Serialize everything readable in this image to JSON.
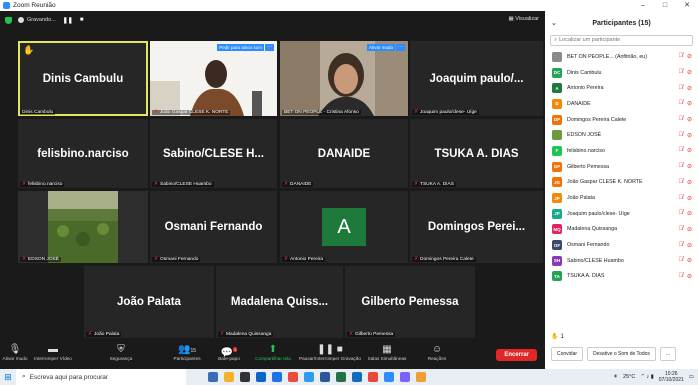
{
  "window": {
    "title": "Zoom Reunião",
    "min": "–",
    "max": "□",
    "close": "✕"
  },
  "meeting": {
    "recording_label": "Gravando...",
    "view_label": "Visualizar"
  },
  "tiles": [
    {
      "name": "Dinis Cambulu",
      "label": "Dinis Cambulu",
      "muted": false
    },
    {
      "name": "",
      "label": "João Gaspar CLESE K. NORTE",
      "muted": true,
      "unmute": "Pedir para ativar som"
    },
    {
      "name": "",
      "label": "BET ON PEOPLE - Cristina Afonso",
      "muted": false,
      "unmute": "Ativar mudo"
    },
    {
      "name": "Joaquim  paulo/...",
      "label": "Joaquim  paulo/clese- Uíge",
      "muted": true
    },
    {
      "name": "felisbino.narciso",
      "label": "felisbino.narciso",
      "muted": true
    },
    {
      "name": "Sabino/CLESE  H...",
      "label": "Sabino/CLESE Huambo",
      "muted": true
    },
    {
      "name": "DANAIDE",
      "label": "DANAIDE",
      "muted": true
    },
    {
      "name": "TSUKA A. DIAS",
      "label": "TSUKA A. DIAS",
      "muted": true
    },
    {
      "name": "",
      "label": "EDSON JOSÉ",
      "muted": true
    },
    {
      "name": "Osmani Fernando",
      "label": "Osmani Fernando",
      "muted": true
    },
    {
      "name": "",
      "label": "Antonio Pereira",
      "muted": true,
      "avatar": "A"
    },
    {
      "name": "Domingos  Perei...",
      "label": "Domingos Pereira Calete",
      "muted": true
    },
    {
      "name": "João Palata",
      "label": "João Palata",
      "muted": true
    },
    {
      "name": "Madalena  Quiss...",
      "label": "Madalena  Quissanga",
      "muted": true
    },
    {
      "name": "Gilberto Pemessa",
      "label": "Gilberto Pemessa",
      "muted": true
    }
  ],
  "toolbar": {
    "mute": "Ativar mudo",
    "video": "Interromper Vídeo",
    "security": "Segurança",
    "participants": "Participantes",
    "participants_count": "15",
    "chat": "Bate-papo",
    "chat_badge": "1",
    "share": "Compartilhar tela",
    "record": "Pausar/Interromper Gravação",
    "rooms": "Salas Simultâneas",
    "reactions": "Reações",
    "end": "Encerrar"
  },
  "panel": {
    "title": "Participantes (15)",
    "search_placeholder": "Localizar um participante",
    "participants": [
      {
        "initials": "",
        "name": "BET ON PEOPLE... (Anfitrião, eu)",
        "color": "#8a8a8a"
      },
      {
        "initials": "DC",
        "name": "Dinis Cambulu",
        "color": "#23a455"
      },
      {
        "initials": "A",
        "name": "Antonio Pereira",
        "color": "#1d7a3a"
      },
      {
        "initials": "D",
        "name": "DANAIDE",
        "color": "#f08a0c"
      },
      {
        "initials": "DP",
        "name": "Domingos Pereira Calete",
        "color": "#f0740c"
      },
      {
        "initials": "",
        "name": "EDSON JOSÉ",
        "color": "#6b9b3a"
      },
      {
        "initials": "F",
        "name": "felisbino.narciso",
        "color": "#23c552"
      },
      {
        "initials": "GP",
        "name": "Gilberto Pemessa",
        "color": "#f0740c"
      },
      {
        "initials": "JG",
        "name": "João Gaspar CLESE K. NORTE",
        "color": "#f0740c"
      },
      {
        "initials": "JP",
        "name": "João Palata",
        "color": "#f08a0c"
      },
      {
        "initials": "JP",
        "name": "Joaquim  paulo/clese- Uíge",
        "color": "#1aaa8a"
      },
      {
        "initials": "MQ",
        "name": "Madalena  Quissanga",
        "color": "#e0245e"
      },
      {
        "initials": "OF",
        "name": "Osmani Fernando",
        "color": "#3a4a6b"
      },
      {
        "initials": "SH",
        "name": "Sabino/CLESE Huambo",
        "color": "#8a3ab9"
      },
      {
        "initials": "TA",
        "name": "TSUKA A. DIAS",
        "color": "#23a455"
      }
    ],
    "raised_hands": "1",
    "invite": "Convidar",
    "mute_all": "Desative o Som de Todos",
    "more": "..."
  },
  "taskbar": {
    "search_placeholder": "Escreva aqui para procurar",
    "temp": "25°C",
    "time": "10:26",
    "date": "07/10/2021"
  }
}
